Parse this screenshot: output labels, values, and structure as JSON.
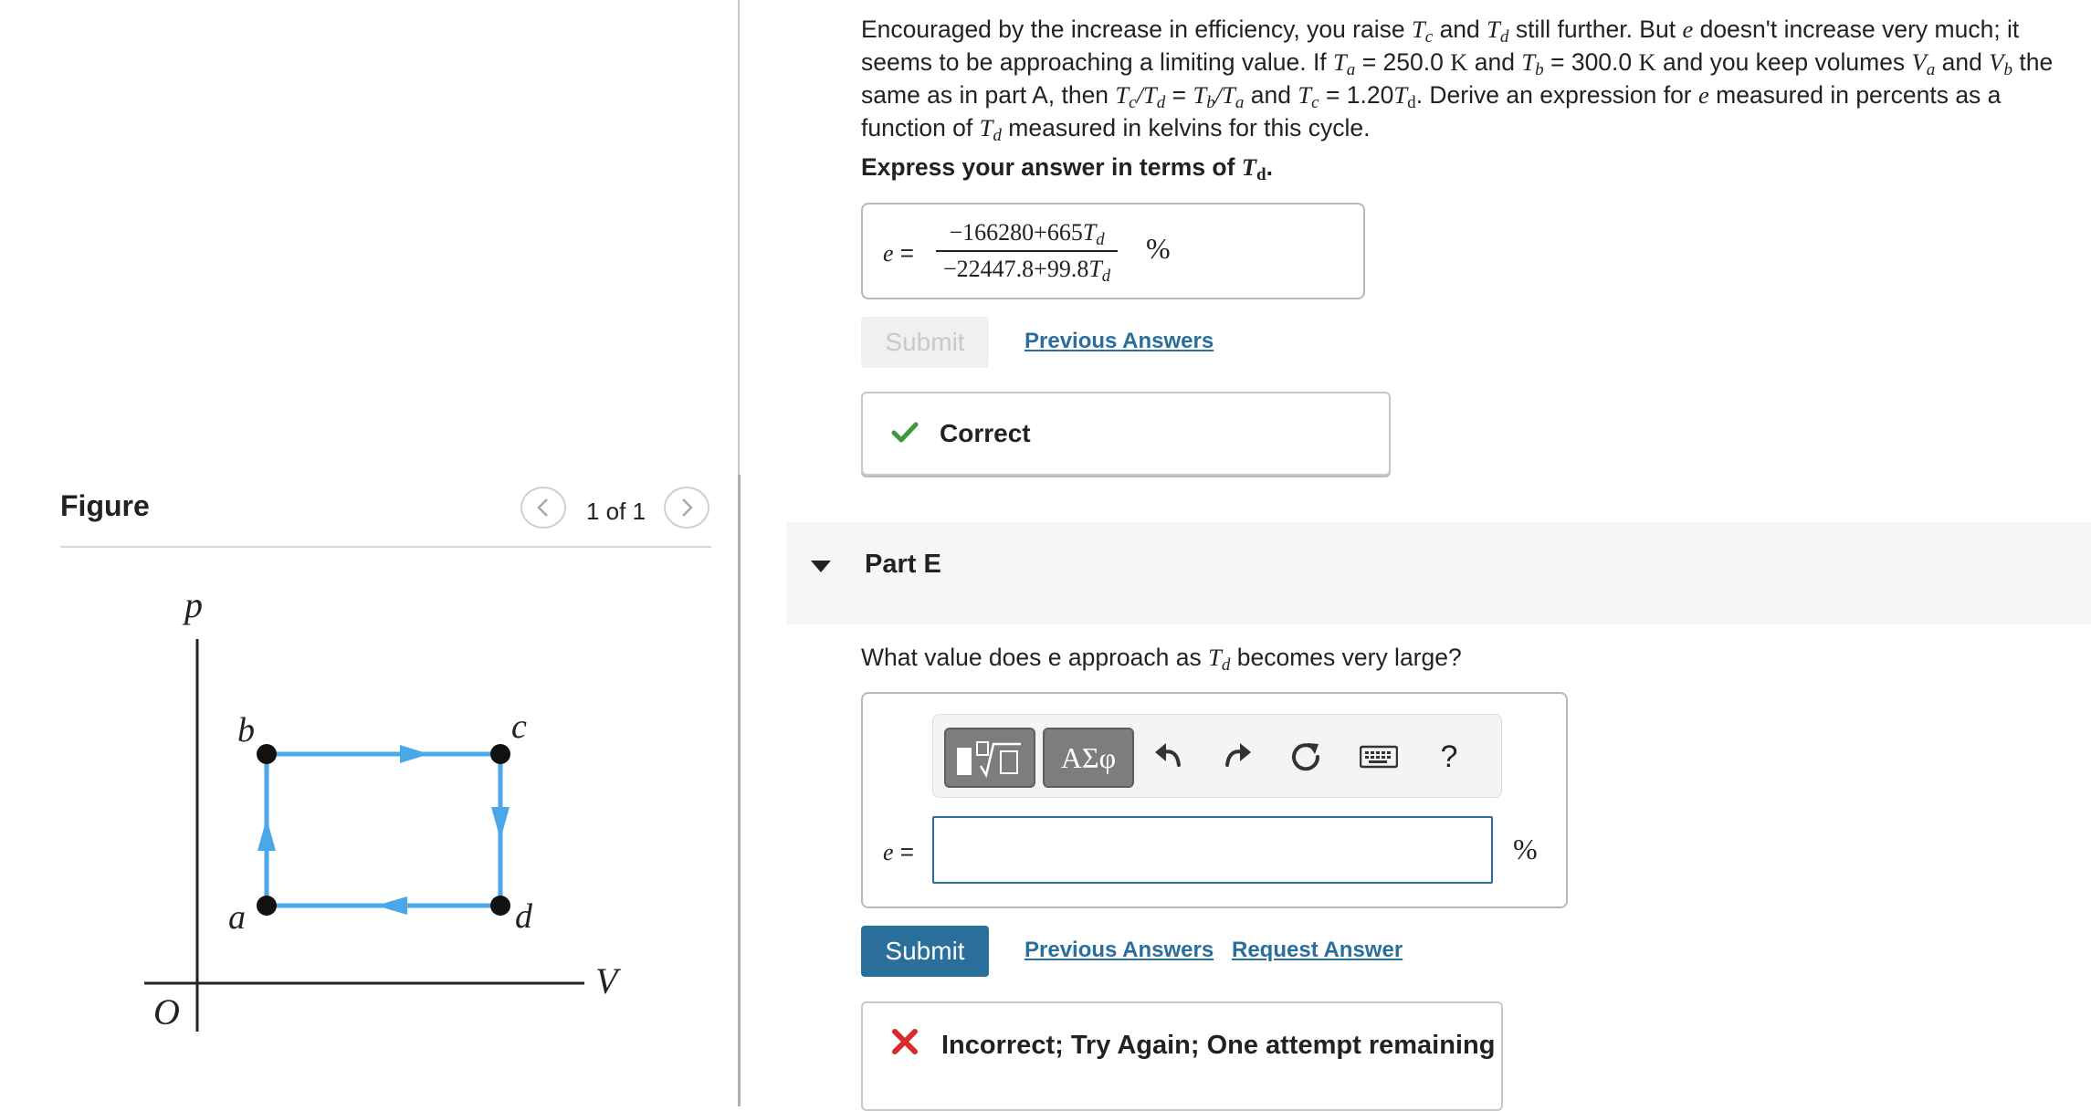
{
  "figure": {
    "title": "Figure",
    "pager": "1 of 1",
    "axes": {
      "y_label": "p",
      "x_label": "V",
      "origin_label": "O"
    },
    "points": [
      "a",
      "b",
      "c",
      "d"
    ],
    "cycle_color": "#4aa8e8"
  },
  "question": {
    "s1": "Encouraged by the increase in efficiency, you raise ",
    "s2": " and ",
    "s3": " still further. But ",
    "s4": " doesn't increase very much; it seems to be approaching a limiting value. If ",
    "s5": " = 250.0 ",
    "s6": " and ",
    "s7": " = 300.0 ",
    "s8": " and you keep volumes ",
    "s9": " and ",
    "s10": " the same as in part A, then ",
    "s11": " = ",
    "s12": " and ",
    "s13": " = 1.20",
    "s14": ". Derive an expression for ",
    "s15": " measured in percents as a function of ",
    "s16": " measured in kelvins for this cycle.",
    "hint_prefix": "Express your answer in terms of ",
    "hint_var": "T",
    "hint_sub": "d",
    "hint_suffix": "."
  },
  "prev_answer": {
    "label": "e =",
    "numerator": "−166280+665",
    "denominator": "−22447.8+99.8",
    "unit": "%"
  },
  "buttons": {
    "submit": "Submit",
    "previous_answers": "Previous Answers",
    "request_answer": "Request Answer"
  },
  "status_correct": "Correct",
  "part_e": {
    "title": "Part E",
    "q_prefix": "What value does e approach as ",
    "q_suffix": " becomes very large?",
    "toolbar": {
      "symbols": "ΑΣφ",
      "help": "?"
    },
    "answer_label": "e =",
    "answer_value": "",
    "unit": "%"
  },
  "status_incorrect": "Incorrect; Try Again; One attempt remaining",
  "colors": {
    "accent": "#2a6e9c",
    "correct": "#3c9a3c",
    "incorrect": "#d62b2b"
  }
}
